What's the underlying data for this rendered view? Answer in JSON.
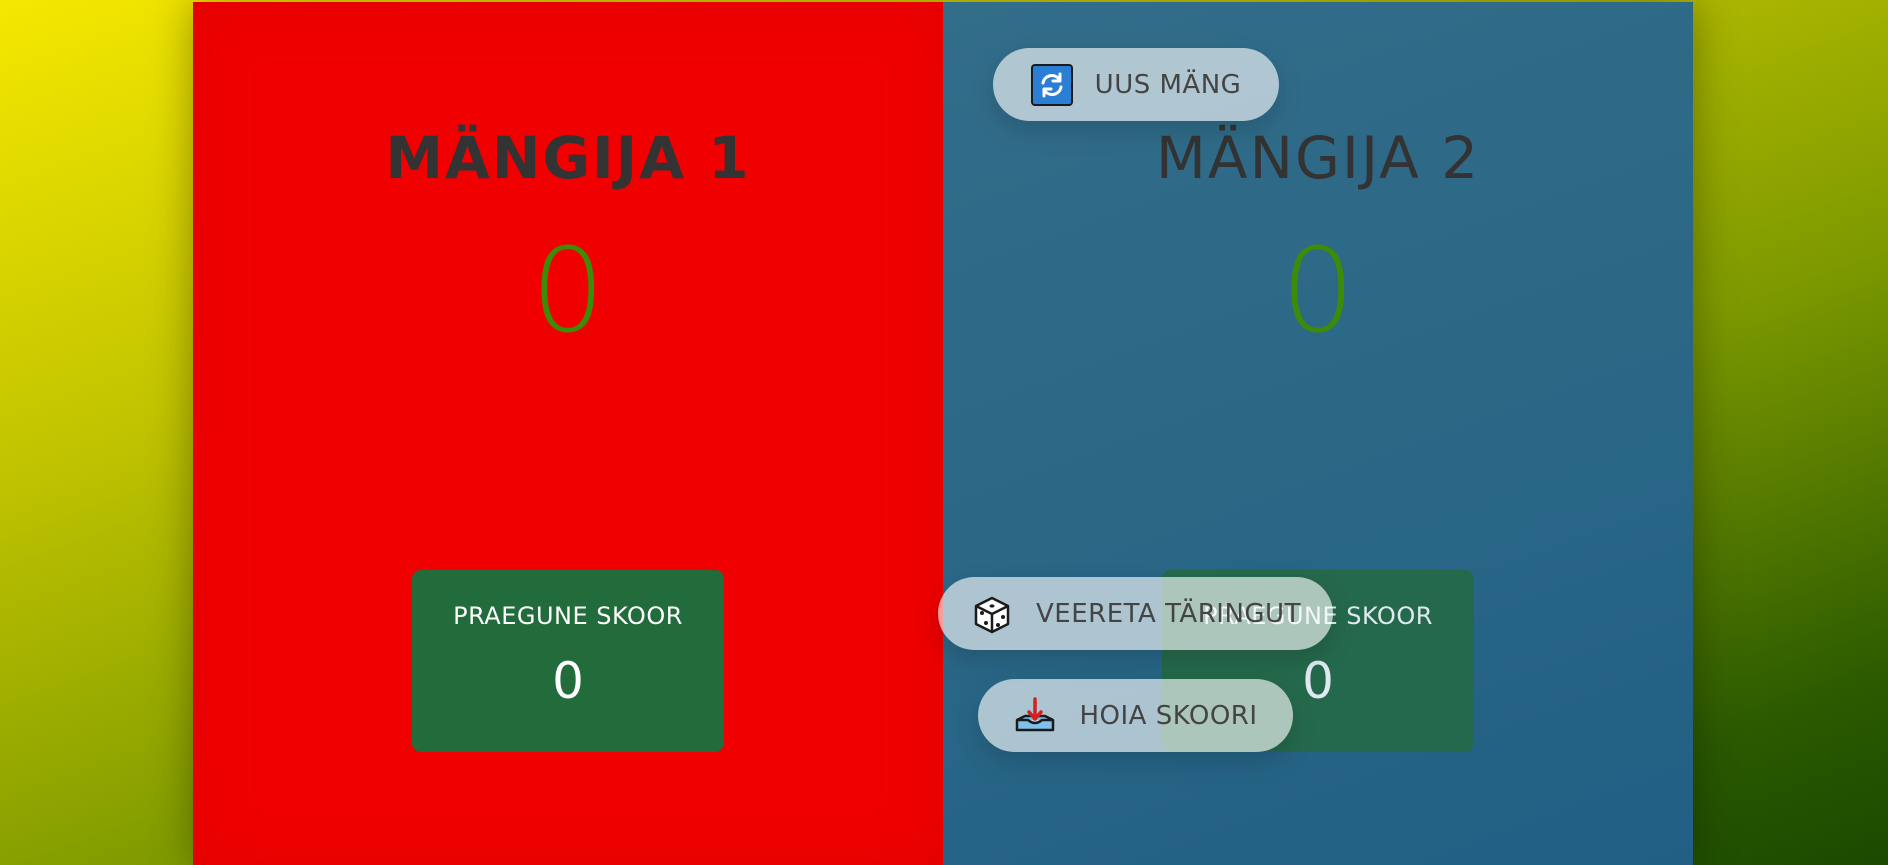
{
  "players": [
    {
      "name": "MÄNGIJA 1",
      "score": "0",
      "current_label": "PRAEGUNE SKOOR",
      "current_score": "0",
      "color": "#f00000",
      "active": true
    },
    {
      "name": "MÄNGIJA 2",
      "score": "0",
      "current_label": "PRAEGUNE SKOOR",
      "current_score": "0",
      "color": "#2b6886",
      "active": false
    }
  ],
  "buttons": {
    "new_game": {
      "label": "UUS MÄNG",
      "icon": "refresh-icon"
    },
    "roll_dice": {
      "label": "VEERETA TÄRINGUT",
      "icon": "dice-icon"
    },
    "hold": {
      "label": "HOIA SKOORI",
      "icon": "inbox-download-icon"
    }
  },
  "colors": {
    "total_score": "#3d8c07",
    "current_box": "#226b3a",
    "background_top": "#f5e800",
    "background_bottom": "#1a4a00"
  }
}
